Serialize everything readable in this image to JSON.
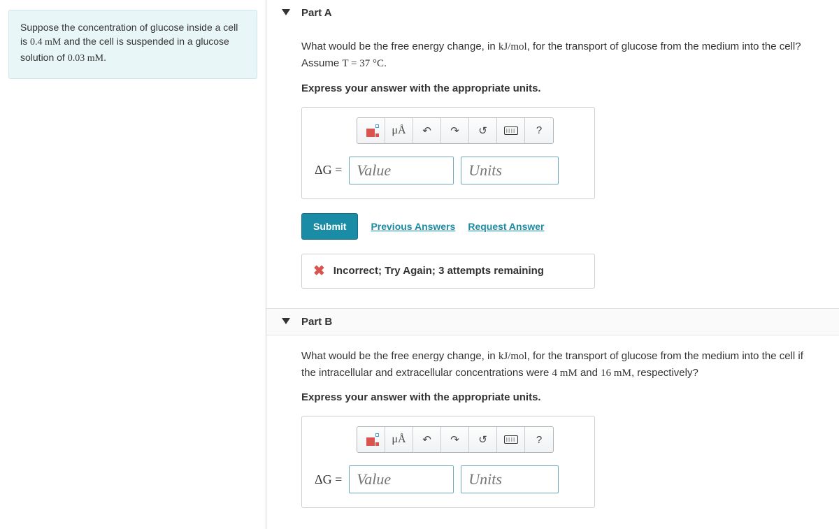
{
  "intro": {
    "pre": "Suppose the concentration of glucose inside a cell is ",
    "c_in": "0.4 mM",
    "mid": " and the cell is suspended in a glucose solution of ",
    "c_out": "0.03 mM",
    "post": "."
  },
  "partA": {
    "title": "Part A",
    "q_pre": "What would be the free energy change, in ",
    "q_unit": "kJ/mol",
    "q_mid": ", for the transport of glucose from the medium into the cell? Assume ",
    "q_temp": "T = 37 °C",
    "q_post": ".",
    "instruction": "Express your answer with the appropriate units.",
    "dg_label": "ΔG =",
    "value_ph": "Value",
    "units_ph": "Units",
    "toolbar": {
      "units_label": "μÅ",
      "help": "?"
    },
    "submit": "Submit",
    "prev": "Previous Answers",
    "req": "Request Answer",
    "feedback": "Incorrect; Try Again; 3 attempts remaining"
  },
  "partB": {
    "title": "Part B",
    "q_pre": "What would be the free energy change, in ",
    "q_unit": "kJ/mol",
    "q_mid": ", for the transport of glucose from the medium into the cell if the intracellular and extracellular concentrations were ",
    "c_in": "4 mM",
    "q_and": " and ",
    "c_out": "16 mM",
    "q_post": ", respectively?",
    "instruction": "Express your answer with the appropriate units.",
    "dg_label": "ΔG =",
    "value_ph": "Value",
    "units_ph": "Units",
    "toolbar": {
      "units_label": "μÅ",
      "help": "?"
    }
  }
}
